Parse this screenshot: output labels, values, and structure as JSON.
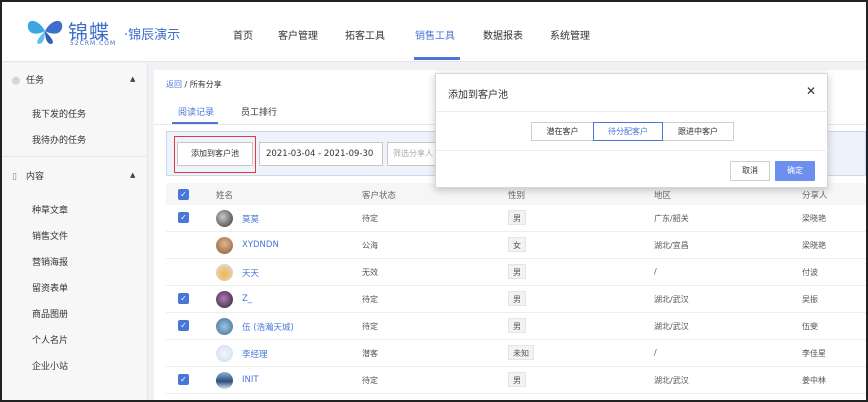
{
  "app": {
    "logo_main": "锦蝶",
    "logo_sub": "52CRM.COM",
    "product": "·锦辰演示"
  },
  "nav": {
    "items": [
      "首页",
      "客户管理",
      "拓客工具",
      "销售工具",
      "数据报表",
      "系统管理"
    ],
    "active": "销售工具"
  },
  "sidebar": {
    "task_group": "任务",
    "task_items": [
      "我下发的任务",
      "我待办的任务"
    ],
    "content_group": "内容",
    "content_items": [
      "种草文章",
      "销售文件",
      "营销海报",
      "留资表单",
      "商品图册",
      "个人名片",
      "企业小站"
    ]
  },
  "breadcrumb": {
    "back": "返回",
    "separator": " / ",
    "current": "所有分享"
  },
  "tabs": [
    "阅读记录",
    "员工排行"
  ],
  "filter": {
    "add_button": "添加到客户池",
    "date_range": "2021-03-04 - 2021-09-30",
    "sharer_placeholder": "筛选分享人"
  },
  "table": {
    "headers": [
      "姓名",
      "客户状态",
      "性别",
      "地区",
      "分享人"
    ],
    "rows": [
      {
        "checked": true,
        "name": "莫莫",
        "status": "待定",
        "gender": "男",
        "region": "广东/韶关",
        "sharer": "梁晓艳"
      },
      {
        "checked": false,
        "name": "XYDNDN",
        "status": "公海",
        "gender": "女",
        "region": "湖北/宜昌",
        "sharer": "梁晓艳"
      },
      {
        "checked": false,
        "name": "天天",
        "status": "无效",
        "gender": "男",
        "region": "/",
        "sharer": "付波"
      },
      {
        "checked": true,
        "name": "Z_",
        "status": "待定",
        "gender": "男",
        "region": "湖北/武汉",
        "sharer": "吴振"
      },
      {
        "checked": true,
        "name": "伍 (浩瀚天城)",
        "status": "待定",
        "gender": "男",
        "region": "湖北/武汉",
        "sharer": "伍斐"
      },
      {
        "checked": false,
        "name": "李经理",
        "status": "潜客",
        "gender": "未知",
        "region": "/",
        "sharer": "李佳星"
      },
      {
        "checked": true,
        "name": "INIT",
        "status": "待定",
        "gender": "男",
        "region": "湖北/武汉",
        "sharer": "姜中林"
      }
    ]
  },
  "dialog": {
    "title": "添加到客户池",
    "options": [
      "潜在客户",
      "待分配客户",
      "跟进中客户"
    ],
    "selected": "待分配客户",
    "cancel": "取消",
    "confirm": "确定"
  },
  "colors": {
    "accent": "#4a76d8",
    "highlight_box": "#e03a3a",
    "ok_button": "#6c8ff0"
  }
}
